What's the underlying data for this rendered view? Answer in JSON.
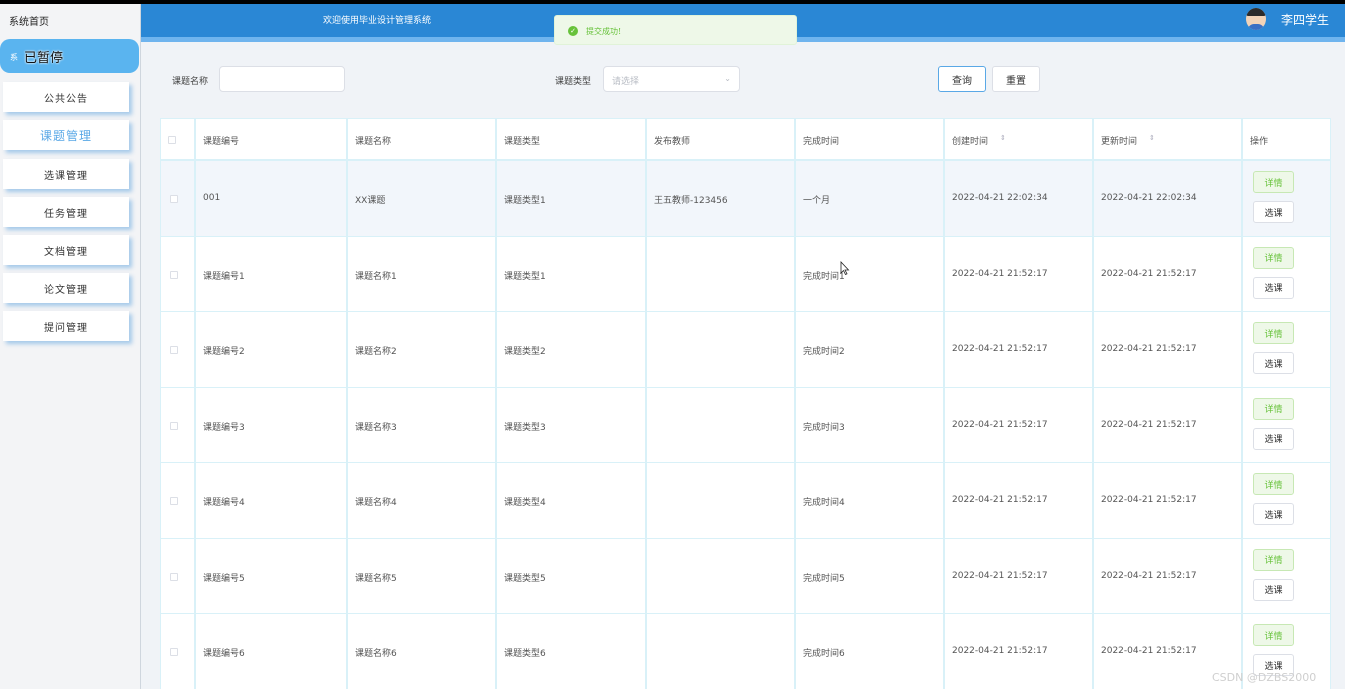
{
  "sidebar": {
    "home": "系统首页",
    "active_small": "系",
    "paused": "已暂停",
    "items": [
      {
        "label": "公共公告"
      },
      {
        "label": "课题管理"
      },
      {
        "label": "选课管理"
      },
      {
        "label": "任务管理"
      },
      {
        "label": "文档管理"
      },
      {
        "label": "论文管理"
      },
      {
        "label": "提问管理"
      }
    ]
  },
  "header": {
    "welcome": "欢迎使用毕业设计管理系统",
    "user_name": "李四学生"
  },
  "toast": {
    "message": "提交成功!"
  },
  "search": {
    "topic_name_label": "课题名称",
    "topic_name_value": "",
    "topic_type_label": "课题类型",
    "topic_type_placeholder": "请选择",
    "query_button": "查询",
    "reset_button": "重置"
  },
  "table": {
    "columns": [
      "课题编号",
      "课题名称",
      "课题类型",
      "发布教师",
      "完成时间",
      "创建时间",
      "更新时间",
      "操作"
    ],
    "detail_label": "详情",
    "select_label": "选课",
    "rows": [
      {
        "code": "001",
        "name": "XX课题",
        "type": "课题类型1",
        "teacher": "王五教师-123456",
        "duration": "一个月",
        "created": "2022-04-21 22:02:34",
        "updated": "2022-04-21 22:02:34"
      },
      {
        "code": "课题编号1",
        "name": "课题名称1",
        "type": "课题类型1",
        "teacher": "",
        "duration": "完成时间1",
        "created": "2022-04-21 21:52:17",
        "updated": "2022-04-21 21:52:17"
      },
      {
        "code": "课题编号2",
        "name": "课题名称2",
        "type": "课题类型2",
        "teacher": "",
        "duration": "完成时间2",
        "created": "2022-04-21 21:52:17",
        "updated": "2022-04-21 21:52:17"
      },
      {
        "code": "课题编号3",
        "name": "课题名称3",
        "type": "课题类型3",
        "teacher": "",
        "duration": "完成时间3",
        "created": "2022-04-21 21:52:17",
        "updated": "2022-04-21 21:52:17"
      },
      {
        "code": "课题编号4",
        "name": "课题名称4",
        "type": "课题类型4",
        "teacher": "",
        "duration": "完成时间4",
        "created": "2022-04-21 21:52:17",
        "updated": "2022-04-21 21:52:17"
      },
      {
        "code": "课题编号5",
        "name": "课题名称5",
        "type": "课题类型5",
        "teacher": "",
        "duration": "完成时间5",
        "created": "2022-04-21 21:52:17",
        "updated": "2022-04-21 21:52:17"
      },
      {
        "code": "课题编号6",
        "name": "课题名称6",
        "type": "课题类型6",
        "teacher": "",
        "duration": "完成时间6",
        "created": "2022-04-21 21:52:17",
        "updated": "2022-04-21 21:52:17"
      }
    ]
  },
  "watermark": "CSDN @DZBS2000",
  "colors": {
    "header": "#2a87d5",
    "accent": "#5ab4ef",
    "success": "#67c23a"
  }
}
